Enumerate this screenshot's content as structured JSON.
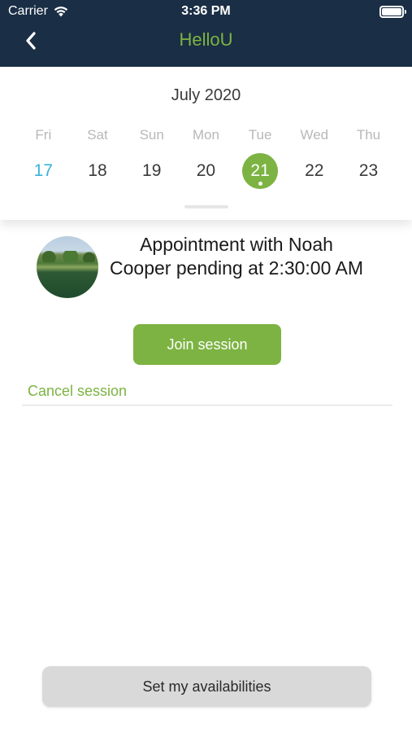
{
  "status_bar": {
    "carrier": "Carrier",
    "time": "3:36 PM"
  },
  "nav": {
    "title": "HelloU",
    "back_icon": "chevron-left-icon"
  },
  "calendar": {
    "month": "July 2020",
    "day_names": [
      "Fri",
      "Sat",
      "Sun",
      "Mon",
      "Tue",
      "Wed",
      "Thu"
    ],
    "dates": [
      "17",
      "18",
      "19",
      "20",
      "21",
      "22",
      "23"
    ],
    "today": "17",
    "selected": "21"
  },
  "appointment": {
    "text": "Appointment with Noah Cooper pending at 2:30:00 AM",
    "join_label": "Join session",
    "cancel_label": "Cancel session"
  },
  "footer": {
    "availability_label": "Set my availabilities"
  },
  "colors": {
    "header_bg": "#1a2e45",
    "accent_green": "#7cb342",
    "today_blue": "#35b3d6"
  }
}
